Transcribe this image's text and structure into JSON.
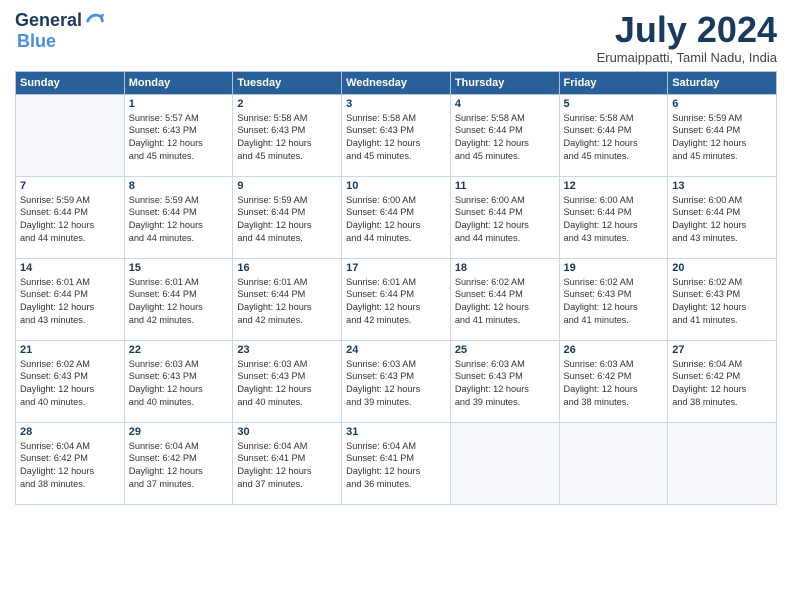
{
  "header": {
    "logo_line1": "General",
    "logo_line2": "Blue",
    "month_year": "July 2024",
    "location": "Erumaippatti, Tamil Nadu, India"
  },
  "days_of_week": [
    "Sunday",
    "Monday",
    "Tuesday",
    "Wednesday",
    "Thursday",
    "Friday",
    "Saturday"
  ],
  "weeks": [
    [
      {
        "day": "",
        "content": ""
      },
      {
        "day": "1",
        "content": "Sunrise: 5:57 AM\nSunset: 6:43 PM\nDaylight: 12 hours\nand 45 minutes."
      },
      {
        "day": "2",
        "content": "Sunrise: 5:58 AM\nSunset: 6:43 PM\nDaylight: 12 hours\nand 45 minutes."
      },
      {
        "day": "3",
        "content": "Sunrise: 5:58 AM\nSunset: 6:43 PM\nDaylight: 12 hours\nand 45 minutes."
      },
      {
        "day": "4",
        "content": "Sunrise: 5:58 AM\nSunset: 6:44 PM\nDaylight: 12 hours\nand 45 minutes."
      },
      {
        "day": "5",
        "content": "Sunrise: 5:58 AM\nSunset: 6:44 PM\nDaylight: 12 hours\nand 45 minutes."
      },
      {
        "day": "6",
        "content": "Sunrise: 5:59 AM\nSunset: 6:44 PM\nDaylight: 12 hours\nand 45 minutes."
      }
    ],
    [
      {
        "day": "7",
        "content": "Sunrise: 5:59 AM\nSunset: 6:44 PM\nDaylight: 12 hours\nand 44 minutes."
      },
      {
        "day": "8",
        "content": "Sunrise: 5:59 AM\nSunset: 6:44 PM\nDaylight: 12 hours\nand 44 minutes."
      },
      {
        "day": "9",
        "content": "Sunrise: 5:59 AM\nSunset: 6:44 PM\nDaylight: 12 hours\nand 44 minutes."
      },
      {
        "day": "10",
        "content": "Sunrise: 6:00 AM\nSunset: 6:44 PM\nDaylight: 12 hours\nand 44 minutes."
      },
      {
        "day": "11",
        "content": "Sunrise: 6:00 AM\nSunset: 6:44 PM\nDaylight: 12 hours\nand 44 minutes."
      },
      {
        "day": "12",
        "content": "Sunrise: 6:00 AM\nSunset: 6:44 PM\nDaylight: 12 hours\nand 43 minutes."
      },
      {
        "day": "13",
        "content": "Sunrise: 6:00 AM\nSunset: 6:44 PM\nDaylight: 12 hours\nand 43 minutes."
      }
    ],
    [
      {
        "day": "14",
        "content": "Sunrise: 6:01 AM\nSunset: 6:44 PM\nDaylight: 12 hours\nand 43 minutes."
      },
      {
        "day": "15",
        "content": "Sunrise: 6:01 AM\nSunset: 6:44 PM\nDaylight: 12 hours\nand 42 minutes."
      },
      {
        "day": "16",
        "content": "Sunrise: 6:01 AM\nSunset: 6:44 PM\nDaylight: 12 hours\nand 42 minutes."
      },
      {
        "day": "17",
        "content": "Sunrise: 6:01 AM\nSunset: 6:44 PM\nDaylight: 12 hours\nand 42 minutes."
      },
      {
        "day": "18",
        "content": "Sunrise: 6:02 AM\nSunset: 6:44 PM\nDaylight: 12 hours\nand 41 minutes."
      },
      {
        "day": "19",
        "content": "Sunrise: 6:02 AM\nSunset: 6:43 PM\nDaylight: 12 hours\nand 41 minutes."
      },
      {
        "day": "20",
        "content": "Sunrise: 6:02 AM\nSunset: 6:43 PM\nDaylight: 12 hours\nand 41 minutes."
      }
    ],
    [
      {
        "day": "21",
        "content": "Sunrise: 6:02 AM\nSunset: 6:43 PM\nDaylight: 12 hours\nand 40 minutes."
      },
      {
        "day": "22",
        "content": "Sunrise: 6:03 AM\nSunset: 6:43 PM\nDaylight: 12 hours\nand 40 minutes."
      },
      {
        "day": "23",
        "content": "Sunrise: 6:03 AM\nSunset: 6:43 PM\nDaylight: 12 hours\nand 40 minutes."
      },
      {
        "day": "24",
        "content": "Sunrise: 6:03 AM\nSunset: 6:43 PM\nDaylight: 12 hours\nand 39 minutes."
      },
      {
        "day": "25",
        "content": "Sunrise: 6:03 AM\nSunset: 6:43 PM\nDaylight: 12 hours\nand 39 minutes."
      },
      {
        "day": "26",
        "content": "Sunrise: 6:03 AM\nSunset: 6:42 PM\nDaylight: 12 hours\nand 38 minutes."
      },
      {
        "day": "27",
        "content": "Sunrise: 6:04 AM\nSunset: 6:42 PM\nDaylight: 12 hours\nand 38 minutes."
      }
    ],
    [
      {
        "day": "28",
        "content": "Sunrise: 6:04 AM\nSunset: 6:42 PM\nDaylight: 12 hours\nand 38 minutes."
      },
      {
        "day": "29",
        "content": "Sunrise: 6:04 AM\nSunset: 6:42 PM\nDaylight: 12 hours\nand 37 minutes."
      },
      {
        "day": "30",
        "content": "Sunrise: 6:04 AM\nSunset: 6:41 PM\nDaylight: 12 hours\nand 37 minutes."
      },
      {
        "day": "31",
        "content": "Sunrise: 6:04 AM\nSunset: 6:41 PM\nDaylight: 12 hours\nand 36 minutes."
      },
      {
        "day": "",
        "content": ""
      },
      {
        "day": "",
        "content": ""
      },
      {
        "day": "",
        "content": ""
      }
    ]
  ]
}
